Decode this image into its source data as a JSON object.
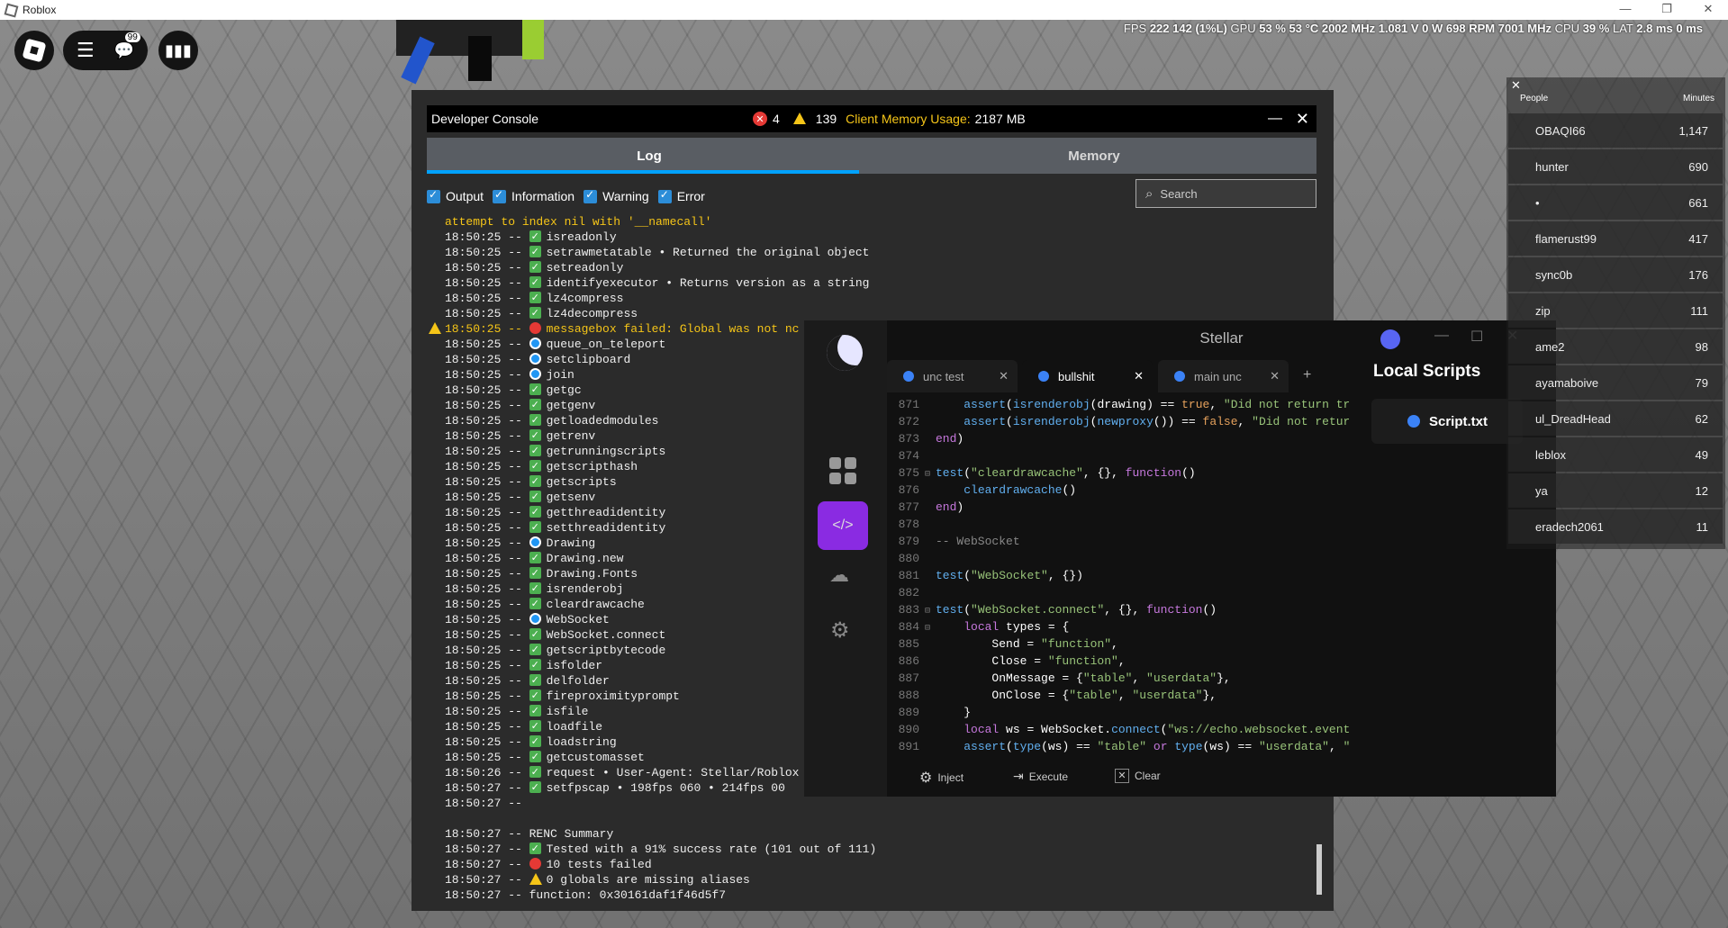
{
  "window": {
    "title": "Roblox"
  },
  "hud": {
    "chat_badge": "99"
  },
  "stats": {
    "fps_label": "FPS",
    "fps": "222",
    "gpu_mhz_part": "142 (1%L)",
    "gpu_label": "GPU",
    "gpu_pct": "53 %",
    "gpu_temp": "53 °C",
    "gpu_clock": "2002 MHz",
    "gpu_volt": "1.081 V",
    "gpu_watt": "0 W",
    "fan": "698 RPM",
    "cpu_clock": "7001 MHz",
    "cpu_label": "CPU",
    "cpu_pct": "39 %",
    "lat_label": "LAT",
    "lat1": "2.8 ms",
    "lat2": "0 ms"
  },
  "devconsole": {
    "title": "Developer Console",
    "errors": "4",
    "warnings": "139",
    "memory_label": "Client Memory Usage:",
    "memory_value": "2187 MB",
    "tabs": [
      "Log",
      "Memory"
    ],
    "filters": [
      "Output",
      "Information",
      "Warning",
      "Error"
    ],
    "search_placeholder": "Search",
    "log": [
      {
        "t": "",
        "i": "",
        "x": "attempt to index nil with '__namecall'",
        "c": "#f5c518"
      },
      {
        "t": "18:50:25 -- ",
        "i": "ok",
        "x": "isreadonly"
      },
      {
        "t": "18:50:25 -- ",
        "i": "ok",
        "x": "setrawmetatable • Returned the original object"
      },
      {
        "t": "18:50:25 -- ",
        "i": "ok",
        "x": "setreadonly"
      },
      {
        "t": "18:50:25 -- ",
        "i": "ok",
        "x": "identifyexecutor • Returns version as a string"
      },
      {
        "t": "18:50:25 -- ",
        "i": "ok",
        "x": "lz4compress"
      },
      {
        "t": "18:50:25 -- ",
        "i": "ok",
        "x": "lz4decompress"
      },
      {
        "t": "18:50:25 -- ",
        "i": "err",
        "x": "messagebox failed: Global was not nc",
        "c": "#f5c518",
        "warn": true
      },
      {
        "t": "18:50:25 -- ",
        "i": "info",
        "x": "queue_on_teleport"
      },
      {
        "t": "18:50:25 -- ",
        "i": "info",
        "x": "setclipboard"
      },
      {
        "t": "18:50:25 -- ",
        "i": "info",
        "x": "join"
      },
      {
        "t": "18:50:25 -- ",
        "i": "ok",
        "x": "getgc"
      },
      {
        "t": "18:50:25 -- ",
        "i": "ok",
        "x": "getgenv"
      },
      {
        "t": "18:50:25 -- ",
        "i": "ok",
        "x": "getloadedmodules"
      },
      {
        "t": "18:50:25 -- ",
        "i": "ok",
        "x": "getrenv"
      },
      {
        "t": "18:50:25 -- ",
        "i": "ok",
        "x": "getrunningscripts"
      },
      {
        "t": "18:50:25 -- ",
        "i": "ok",
        "x": "getscripthash"
      },
      {
        "t": "18:50:25 -- ",
        "i": "ok",
        "x": "getscripts"
      },
      {
        "t": "18:50:25 -- ",
        "i": "ok",
        "x": "getsenv"
      },
      {
        "t": "18:50:25 -- ",
        "i": "ok",
        "x": "getthreadidentity"
      },
      {
        "t": "18:50:25 -- ",
        "i": "ok",
        "x": "setthreadidentity"
      },
      {
        "t": "18:50:25 -- ",
        "i": "info",
        "x": "Drawing"
      },
      {
        "t": "18:50:25 -- ",
        "i": "ok",
        "x": "Drawing.new"
      },
      {
        "t": "18:50:25 -- ",
        "i": "ok",
        "x": "Drawing.Fonts"
      },
      {
        "t": "18:50:25 -- ",
        "i": "ok",
        "x": "isrenderobj"
      },
      {
        "t": "18:50:25 -- ",
        "i": "ok",
        "x": "cleardrawcache"
      },
      {
        "t": "18:50:25 -- ",
        "i": "info",
        "x": "WebSocket"
      },
      {
        "t": "18:50:25 -- ",
        "i": "ok",
        "x": "WebSocket.connect"
      },
      {
        "t": "18:50:25 -- ",
        "i": "ok",
        "x": "getscriptbytecode"
      },
      {
        "t": "18:50:25 -- ",
        "i": "ok",
        "x": "isfolder"
      },
      {
        "t": "18:50:25 -- ",
        "i": "ok",
        "x": "delfolder"
      },
      {
        "t": "18:50:25 -- ",
        "i": "ok",
        "x": "fireproximityprompt"
      },
      {
        "t": "18:50:25 -- ",
        "i": "ok",
        "x": "isfile"
      },
      {
        "t": "18:50:25 -- ",
        "i": "ok",
        "x": "loadfile"
      },
      {
        "t": "18:50:25 -- ",
        "i": "ok",
        "x": "loadstring"
      },
      {
        "t": "18:50:25 -- ",
        "i": "ok",
        "x": "getcustomasset"
      },
      {
        "t": "18:50:26 -- ",
        "i": "ok",
        "x": "request • User-Agent: Stellar/Roblox"
      },
      {
        "t": "18:50:27 -- ",
        "i": "ok",
        "x": "setfpscap • 198fps 060 • 214fps 00"
      },
      {
        "t": "18:50:27 -- ",
        "i": "",
        "x": ""
      },
      {
        "t": "",
        "i": "",
        "x": ""
      },
      {
        "t": "18:50:27 -- ",
        "i": "",
        "x": "RENC Summary"
      },
      {
        "t": "18:50:27 -- ",
        "i": "ok",
        "x": "Tested with a 91% success rate (101 out of 111)"
      },
      {
        "t": "18:50:27 -- ",
        "i": "err",
        "x": "10 tests failed"
      },
      {
        "t": "18:50:27 -- ",
        "i": "warn",
        "x": "0 globals are missing aliases"
      },
      {
        "t": "18:50:27 -- ",
        "i": "",
        "x": "function: 0x30161daf1f46d5f7"
      }
    ]
  },
  "stellar": {
    "title": "Stellar",
    "tabs": [
      "unc test",
      "bullshit",
      "main unc"
    ],
    "add_tab": "+",
    "local_scripts_title": "Local Scripts",
    "script_name": "Script.txt",
    "buttons": [
      "Inject",
      "Execute",
      "Clear"
    ],
    "code": [
      {
        "n": "871",
        "h": "    <span class='fn'>assert</span>(<span class='fn'>isrenderobj</span>(drawing) == <span class='bo'>true</span>, <span class='st'>\"Did not return true</span>"
      },
      {
        "n": "872",
        "h": "    <span class='fn'>assert</span>(<span class='fn'>isrenderobj</span>(<span class='fn'>newproxy</span>()) == <span class='bo'>false</span>, <span class='st'>\"Did not return</span>"
      },
      {
        "n": "873",
        "h": "<span class='kw'>end</span>)"
      },
      {
        "n": "874",
        "h": ""
      },
      {
        "n": "875",
        "h": "<span class='fn'>test</span>(<span class='st'>\"cleardrawcache\"</span>, {}, <span class='kw'>function</span>()",
        "f": true
      },
      {
        "n": "876",
        "h": "    <span class='fn'>cleardrawcache</span>()"
      },
      {
        "n": "877",
        "h": "<span class='kw'>end</span>)"
      },
      {
        "n": "878",
        "h": ""
      },
      {
        "n": "879",
        "h": "<span class='cm'>-- WebSocket</span>"
      },
      {
        "n": "880",
        "h": ""
      },
      {
        "n": "881",
        "h": "<span class='fn'>test</span>(<span class='st'>\"WebSocket\"</span>, {})"
      },
      {
        "n": "882",
        "h": ""
      },
      {
        "n": "883",
        "h": "<span class='fn'>test</span>(<span class='st'>\"WebSocket.connect\"</span>, {}, <span class='kw'>function</span>()",
        "f": true
      },
      {
        "n": "884",
        "h": "    <span class='kw'>local</span> types = {",
        "f": true
      },
      {
        "n": "885",
        "h": "        Send = <span class='st'>\"function\"</span>,"
      },
      {
        "n": "886",
        "h": "        Close = <span class='st'>\"function\"</span>,"
      },
      {
        "n": "887",
        "h": "        OnMessage = {<span class='st'>\"table\"</span>, <span class='st'>\"userdata\"</span>},"
      },
      {
        "n": "888",
        "h": "        OnClose = {<span class='st'>\"table\"</span>, <span class='st'>\"userdata\"</span>},"
      },
      {
        "n": "889",
        "h": "    }"
      },
      {
        "n": "890",
        "h": "    <span class='kw'>local</span> ws = WebSocket.<span class='fn'>connect</span>(<span class='st'>\"ws://echo.websocket.events\"</span>"
      },
      {
        "n": "891",
        "h": "    <span class='fn'>assert</span>(<span class='fn'>type</span>(ws) == <span class='st'>\"table\"</span> <span class='kw'>or</span> <span class='fn'>type</span>(ws) == <span class='st'>\"userdata\"</span>, <span class='st'>\"Di</span>"
      }
    ]
  },
  "leaderboard": {
    "col_people": "People",
    "col_minutes": "Minutes",
    "rows": [
      {
        "name": "OBAQI66",
        "minutes": "1,147"
      },
      {
        "name": "hunter",
        "minutes": "690"
      },
      {
        "name": "•",
        "minutes": "661"
      },
      {
        "name": "flamerust99",
        "minutes": "417"
      },
      {
        "name": "sync0b",
        "minutes": "176"
      },
      {
        "name": "zip",
        "minutes": "111"
      },
      {
        "name": "ame2",
        "minutes": "98"
      },
      {
        "name": "ayamaboive",
        "minutes": "79"
      },
      {
        "name": "ul_DreadHead",
        "minutes": "62"
      },
      {
        "name": "leblox",
        "minutes": "49"
      },
      {
        "name": "ya",
        "minutes": "12"
      },
      {
        "name": "eradech2061",
        "minutes": "11"
      }
    ]
  }
}
